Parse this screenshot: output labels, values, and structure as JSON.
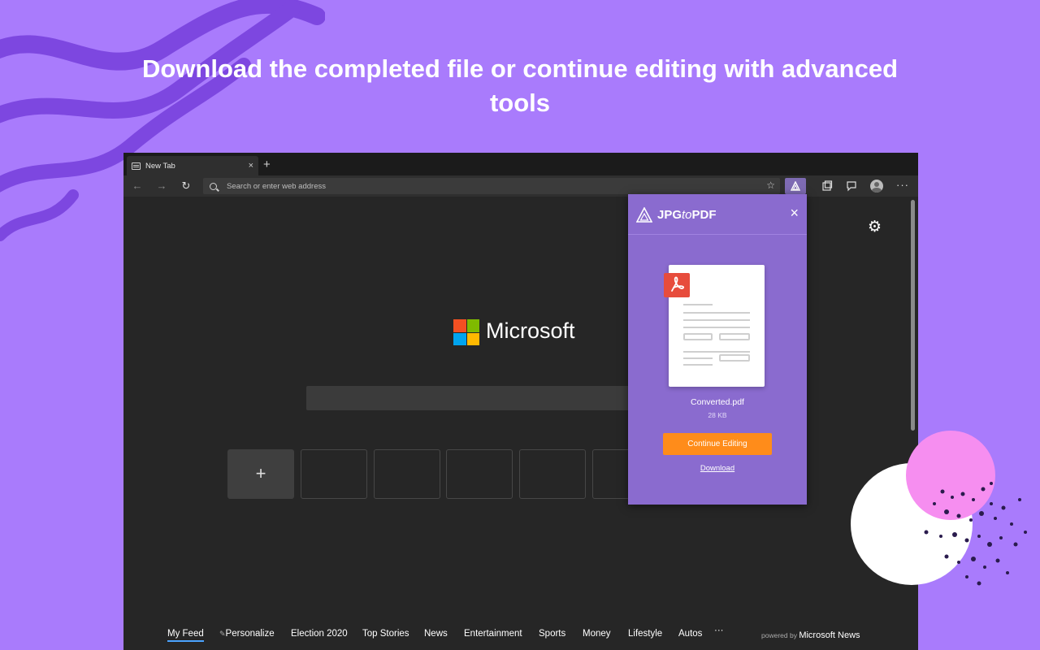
{
  "headline": "Download the completed file or continue editing with advanced tools",
  "browser": {
    "tab_title": "New Tab",
    "tab_close": "×",
    "new_tab": "+",
    "address_placeholder": "Search or enter web address",
    "back": "←",
    "forward": "→",
    "reload": "↻",
    "star": "☆",
    "more": "···",
    "gear": "⚙"
  },
  "newtab_page": {
    "brand": "Microsoft",
    "logo_colors": [
      "#f25022",
      "#7fba00",
      "#00a4ef",
      "#ffb900"
    ],
    "add_tile": "+",
    "news_links": [
      "My Feed",
      "Personalize",
      "Election 2020",
      "Top Stories",
      "News",
      "Entertainment",
      "Sports",
      "Money",
      "Lifestyle",
      "Autos",
      "···"
    ],
    "powered_by_prefix": "powered by",
    "powered_by_brand": "Microsoft News"
  },
  "popup": {
    "brand_prefix": "JPG",
    "brand_mid": "to",
    "brand_suffix": "PDF",
    "close": "×",
    "file_name": "Converted.pdf",
    "file_size": "28 KB",
    "continue_label": "Continue Editing",
    "download_label": "Download"
  },
  "colors": {
    "background": "#a97bfc",
    "popup": "#8a6bcf",
    "cta": "#ff8c1a",
    "pdf_badge": "#e74c3c"
  }
}
